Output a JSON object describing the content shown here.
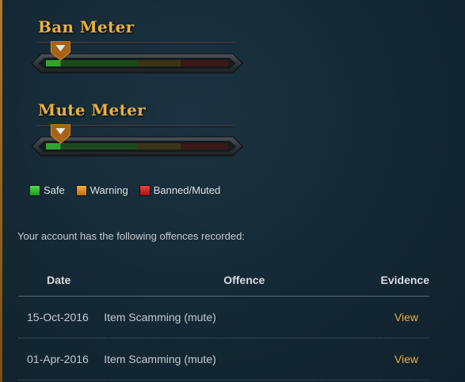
{
  "meters": [
    {
      "title": "Ban Meter",
      "level": 0.08
    },
    {
      "title": "Mute Meter",
      "level": 0.08
    }
  ],
  "legend": [
    {
      "label": "Safe",
      "color": "#2bbf2b"
    },
    {
      "label": "Warning",
      "color": "#e08a14"
    },
    {
      "label": "Banned/Muted",
      "color": "#cc2020"
    }
  ],
  "intro_text": "Your account has the following offences recorded:",
  "table": {
    "headers": [
      "Date",
      "Offence",
      "Evidence"
    ],
    "rows": [
      {
        "date": "15-Oct-2016",
        "offence": "Item Scamming (mute)",
        "evidence": "View"
      },
      {
        "date": "01-Apr-2016",
        "offence": "Item Scamming (mute)",
        "evidence": "View"
      }
    ]
  },
  "colors": {
    "accent": "#e9b040",
    "meter_safe": "#1f6b1f",
    "meter_warning": "#5a4a16",
    "meter_danger": "#5a1a1a"
  }
}
